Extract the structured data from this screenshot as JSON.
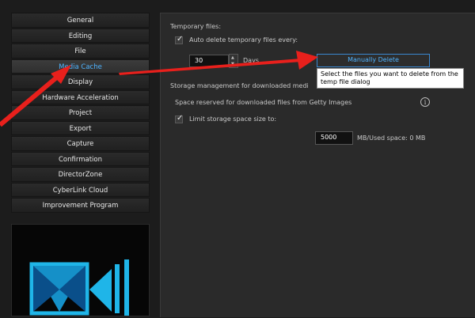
{
  "sidebar": {
    "items": [
      {
        "label": "General",
        "active": false
      },
      {
        "label": "Editing",
        "active": false
      },
      {
        "label": "File",
        "active": false
      },
      {
        "label": "Media Cache",
        "active": true
      },
      {
        "label": "Display",
        "active": false
      },
      {
        "label": "Hardware Acceleration",
        "active": false
      },
      {
        "label": "Project",
        "active": false
      },
      {
        "label": "Export",
        "active": false
      },
      {
        "label": "Capture",
        "active": false
      },
      {
        "label": "Confirmation",
        "active": false
      },
      {
        "label": "DirectorZone",
        "active": false
      },
      {
        "label": "CyberLink Cloud",
        "active": false
      },
      {
        "label": "Improvement Program",
        "active": false
      }
    ]
  },
  "temp_files": {
    "heading": "Temporary files:",
    "auto_delete_label": "Auto delete temporary files every:",
    "auto_delete_checked": true,
    "days_value": "30",
    "days_unit": "Days",
    "manual_delete_button": "Manually Delete",
    "tooltip": "Select the files you want to delete from the temp file dialog"
  },
  "storage": {
    "heading": "Storage management for downloaded medi",
    "reserved_label": "Space reserved for downloaded files from Getty Images",
    "limit_label": "Limit storage space size to:",
    "limit_checked": true,
    "size_value": "5000",
    "size_unit": "MB/Used space: 0 MB"
  },
  "colors": {
    "accent": "#4fb3ff",
    "arrow": "#e8201c"
  }
}
